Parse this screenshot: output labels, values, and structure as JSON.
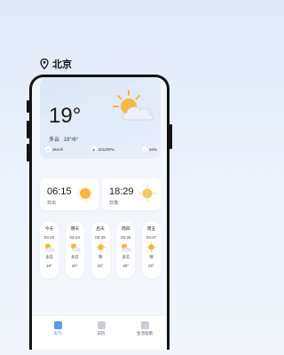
{
  "location": {
    "city": "北京",
    "icon": "location-pin-icon"
  },
  "current": {
    "temperature": "19°",
    "condition": "多云",
    "range": "19°/6°",
    "icon": "partly-cloudy-icon",
    "stats": [
      {
        "icon": "wind-icon",
        "value": "3km/h"
      },
      {
        "icon": "pressure-icon",
        "value": "1010hPa"
      },
      {
        "icon": "humidity-icon",
        "value": "34%"
      }
    ]
  },
  "sun": [
    {
      "time": "06:15",
      "label": "日出",
      "icon": "sunrise-icon"
    },
    {
      "time": "18:29",
      "label": "日落",
      "icon": "sunset-icon"
    }
  ],
  "forecast": [
    {
      "day": "今天",
      "date": "03-23",
      "condition": "多云",
      "temp": "19°",
      "icon": "partly-cloudy-icon"
    },
    {
      "day": "明天",
      "date": "03-24",
      "condition": "多云",
      "temp": "20°",
      "icon": "partly-cloudy-icon"
    },
    {
      "day": "后天",
      "date": "03-25",
      "condition": "晴",
      "temp": "23°",
      "icon": "sunny-icon"
    },
    {
      "day": "周四",
      "date": "03-26",
      "condition": "多云",
      "temp": "20°",
      "icon": "partly-cloudy-icon"
    },
    {
      "day": "周五",
      "date": "03-27",
      "condition": "晴",
      "temp": "20°",
      "icon": "sunny-icon"
    }
  ],
  "tabs": [
    {
      "label": "天气",
      "active": true,
      "icon": "weather-tab-icon"
    },
    {
      "label": "日历",
      "active": false,
      "icon": "calendar-tab-icon"
    },
    {
      "label": "生活指南",
      "active": false,
      "icon": "life-guide-tab-icon"
    }
  ],
  "colors": {
    "accent": "#3b7be0",
    "sun": "#f5b63f",
    "cloud": "#eef2f8"
  }
}
